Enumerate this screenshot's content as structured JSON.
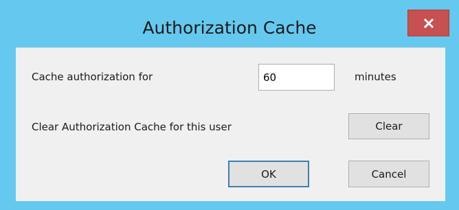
{
  "window": {
    "title": "Authorization Cache",
    "close_icon": "close-icon"
  },
  "form": {
    "cache_label": "Cache authorization for",
    "cache_value": "60",
    "cache_unit": "minutes",
    "clear_label": "Clear Authorization Cache for this user"
  },
  "buttons": {
    "clear": "Clear",
    "ok": "OK",
    "cancel": "Cancel"
  },
  "colors": {
    "frame": "#65c9ef",
    "close_button": "#c75050",
    "client": "#f0f0f0"
  }
}
